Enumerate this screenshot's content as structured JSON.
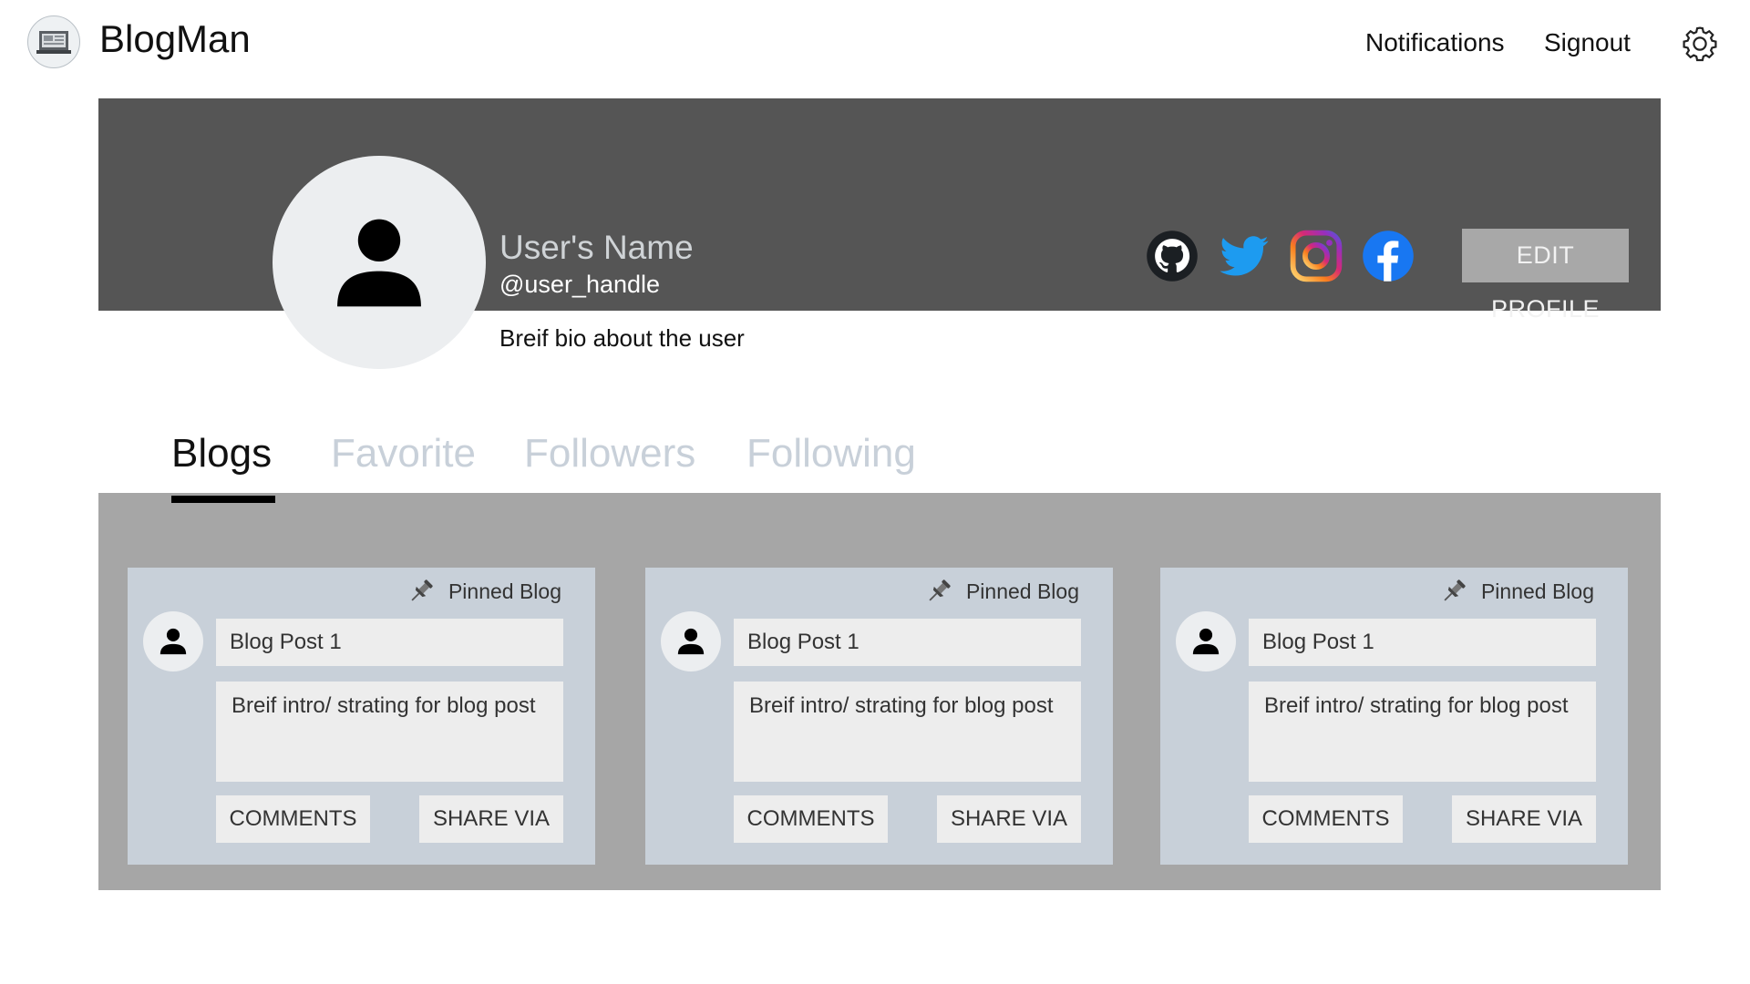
{
  "header": {
    "app_title": "BlogMan",
    "notifications_label": "Notifications",
    "signout_label": "Signout",
    "icons": {
      "logo": "laptop-icon",
      "settings": "gear-icon"
    }
  },
  "profile": {
    "name": "User's Name",
    "handle": "@user_handle",
    "bio": "Breif bio about the user",
    "edit_label": "EDIT PROFILE",
    "social": [
      {
        "icon": "github-icon",
        "color": "#1b1f23"
      },
      {
        "icon": "twitter-icon",
        "color": "#1d9bf0"
      },
      {
        "icon": "instagram-icon",
        "color": "#dd2a7b"
      },
      {
        "icon": "facebook-icon",
        "color": "#1877f2"
      }
    ],
    "colors": {
      "banner": "#555555",
      "name": "#cfd3d6"
    }
  },
  "tabs": [
    {
      "label": "Blogs",
      "active": true
    },
    {
      "label": "Favorite",
      "active": false
    },
    {
      "label": "Followers",
      "active": false
    },
    {
      "label": "Following",
      "active": false
    }
  ],
  "blogs": [
    {
      "pinned_label": "Pinned Blog",
      "title": "Blog Post 1",
      "intro": "Breif intro/ strating for blog post",
      "comments_label": "COMMENTS",
      "share_label": "SHARE VIA"
    },
    {
      "pinned_label": "Pinned Blog",
      "title": "Blog Post 1",
      "intro": "Breif intro/ strating for blog post",
      "comments_label": "COMMENTS",
      "share_label": "SHARE VIA"
    },
    {
      "pinned_label": "Pinned Blog",
      "title": "Blog Post 1",
      "intro": "Breif intro/ strating for blog post",
      "comments_label": "COMMENTS",
      "share_label": "SHARE VIA"
    }
  ],
  "colors": {
    "panel": "#a6a6a6",
    "card": "#c8d0d9",
    "field": "#ededed",
    "inactive_tab": "#c8d0d9"
  }
}
